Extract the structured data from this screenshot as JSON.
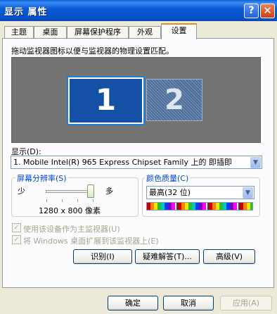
{
  "window": {
    "title": "显示 属性",
    "help_label": "?",
    "close_label": "✕"
  },
  "tabs": [
    "主题",
    "桌面",
    "屏幕保护程序",
    "外观",
    "设置"
  ],
  "active_tab": "设置",
  "settings": {
    "instruction": "拖动监视器图标以便与监视器的物理设置匹配。",
    "monitors": [
      "1",
      "2"
    ],
    "display_label": "显示(D):",
    "display_value": "1. Mobile Intel(R) 965 Express Chipset Family 上的 即插即",
    "resolution": {
      "title": "屏幕分辨率(S)",
      "less": "少",
      "more": "多",
      "value_text": "1280 x 800 像素",
      "slider_fraction": 1.0
    },
    "color_quality": {
      "title": "颜色质量(C)",
      "value": "最高(32 位)"
    },
    "checkboxes": [
      {
        "label": "使用该设备作为主监视器(U)",
        "checked": true,
        "enabled": false
      },
      {
        "label": "将 Windows 桌面扩展到该监视器上(E)",
        "checked": true,
        "enabled": false
      }
    ],
    "buttons": {
      "identify": "识别(I)",
      "troubleshoot": "疑难解答(T)...",
      "advanced": "高级(V)"
    }
  },
  "dialog_buttons": {
    "ok": "确定",
    "cancel": "取消",
    "apply": "应用(A)"
  },
  "colors": {
    "titlebar": "#0a5fd8",
    "dialog_bg": "#ece9d8",
    "monitor_area": "#747474",
    "primary_monitor": "#1451a6",
    "group_title": "#0046d5",
    "active_tab_accent": "#e68b2c"
  }
}
